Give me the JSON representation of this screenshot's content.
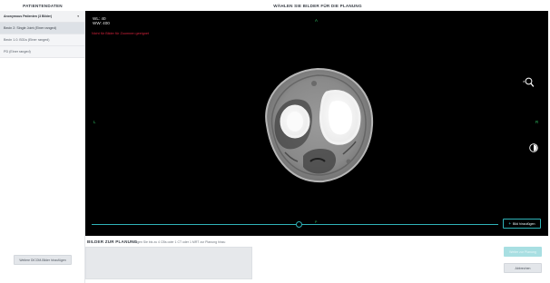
{
  "left_panel": {
    "title": "PATIENTENDATEN",
    "patient": {
      "name": "Anonymous Patienten (3 Bilder)",
      "chevron": "▾"
    },
    "series": [
      {
        "label": "Becin 2: Single Joint (Einer ranged)"
      },
      {
        "label": "Becin 1.0. B31s (Einer ranged)"
      },
      {
        "label": "PD (Einer ranged)"
      }
    ],
    "more_button": "Weitere DICOM-Bilder hinzufügen"
  },
  "viewer": {
    "title": "WÄHLEN SIE BILDER FÜR DIE PLANUNG",
    "window_level": "WL: 40",
    "window_width": "WW: 400",
    "warning": "Nicht für Bilder für Zoomnen geeignet",
    "orientation": {
      "top": "A",
      "left": "L",
      "right": "R",
      "bottom": "P"
    },
    "slice_position": 0.51,
    "add_button": "Bild hinzufügen",
    "icons": {
      "zoom": "magnifier-zoom-icon",
      "contrast": "contrast-icon",
      "add": "plus-icon"
    }
  },
  "planning": {
    "title": "BILDER ZUR PLANUNG",
    "hint": "Fügen Sie bis zu 4 CBs oder 1 CT oder 1 MRT zur Planung hinzu"
  },
  "actions": {
    "continue": "Weiter zur Planung",
    "cancel": "Abbrechen"
  },
  "colors": {
    "accent": "#2fb3b8",
    "orientation": "#2fbd62",
    "warning": "#d8233d",
    "viewer_bg": "#000000"
  }
}
